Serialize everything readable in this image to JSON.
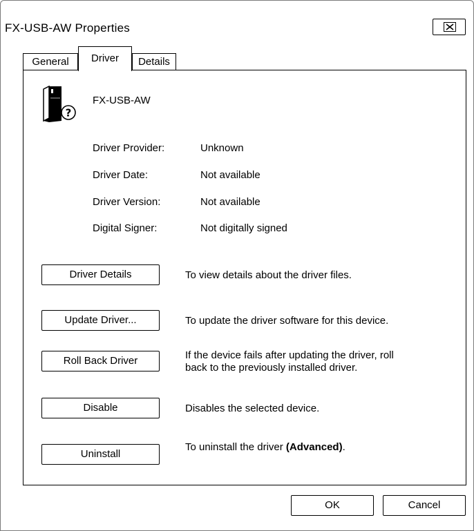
{
  "window": {
    "title": "FX-USB-AW Properties",
    "close_label": "×"
  },
  "tabs": [
    {
      "label": "General"
    },
    {
      "label": "Driver"
    },
    {
      "label": "Details"
    }
  ],
  "device": {
    "icon": "unknown-device-icon",
    "name": "FX-USB-AW"
  },
  "properties": [
    {
      "label": "Driver Provider:",
      "value": "Unknown"
    },
    {
      "label": "Driver Date:",
      "value": "Not available"
    },
    {
      "label": "Driver Version:",
      "value": "Not available"
    },
    {
      "label": "Digital Signer:",
      "value": "Not digitally signed"
    }
  ],
  "actions": [
    {
      "button": "Driver Details",
      "description": "To view details about the driver files."
    },
    {
      "button": "Update Driver...",
      "description": "To update the driver software for this device."
    },
    {
      "button": "Roll Back Driver",
      "description_line1": "If the device fails after updating the driver, roll",
      "description_line2": "back to the previously installed driver."
    },
    {
      "button": "Disable",
      "description": "Disables the selected device."
    },
    {
      "button": "Uninstall",
      "description_prefix": "To uninstall the driver ",
      "description_bold": "(Advanced)",
      "description_suffix": "."
    }
  ],
  "footer": {
    "ok_label": "OK",
    "cancel_label": "Cancel"
  }
}
